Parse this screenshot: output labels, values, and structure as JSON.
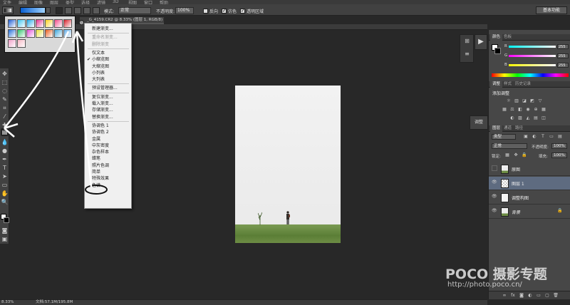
{
  "menubar": [
    "文件",
    "编辑",
    "图像",
    "图层",
    "类型",
    "选择",
    "滤镜",
    "3D",
    "视图",
    "窗口",
    "帮助"
  ],
  "options": {
    "mode_label": "模式:",
    "mode_value": "正常",
    "opacity_label": "不透明度:",
    "opacity_value": "100%",
    "reverse_label": "反向",
    "dither_label": "仿色",
    "transparency_label": "透明区域",
    "workspace": "基本功能"
  },
  "doc_tab": "_G_4159.CR2 @ 8.33% (图层 1, RGB/8) *",
  "gradient_swatches": [
    [
      "#1f5fd4",
      "#3ec6f0",
      "#21a9e8",
      "#e8338f",
      "#ffd21e",
      "#f44d8b",
      "#d8202a"
    ],
    [
      "#2570d8",
      "#2fc56b",
      "#e24fd8",
      "#e8e23a",
      "#eb5f1d",
      "#3da6dc",
      "#66b0ea"
    ],
    [
      "#f0a0c8",
      "#f6b8c4"
    ]
  ],
  "menu": {
    "items": [
      {
        "label": "新建渐变...",
        "disabled": false,
        "checked": false
      },
      {
        "sep": true
      },
      {
        "label": "重命名渐变...",
        "disabled": true,
        "checked": false
      },
      {
        "label": "删除渐变",
        "disabled": true,
        "checked": false
      },
      {
        "sep": true
      },
      {
        "label": "仅文本",
        "disabled": false,
        "checked": false
      },
      {
        "label": "小缩览图",
        "disabled": false,
        "checked": true
      },
      {
        "label": "大缩览图",
        "disabled": false,
        "checked": false
      },
      {
        "label": "小列表",
        "disabled": false,
        "checked": false
      },
      {
        "label": "大列表",
        "disabled": false,
        "checked": false
      },
      {
        "sep": true
      },
      {
        "label": "预设管理器...",
        "disabled": false,
        "checked": false
      },
      {
        "sep": true
      },
      {
        "label": "复位渐变...",
        "disabled": false,
        "checked": false
      },
      {
        "label": "载入渐变...",
        "disabled": false,
        "checked": false
      },
      {
        "label": "存储渐变...",
        "disabled": false,
        "checked": false
      },
      {
        "label": "替换渐变...",
        "disabled": false,
        "checked": false
      },
      {
        "sep": true
      },
      {
        "label": "协调色 1",
        "disabled": false,
        "checked": false
      },
      {
        "label": "协调色 2",
        "disabled": false,
        "checked": false
      },
      {
        "label": "金属",
        "disabled": false,
        "checked": false
      },
      {
        "label": "中灰密度",
        "disabled": false,
        "checked": false
      },
      {
        "label": "杂色样本",
        "disabled": false,
        "checked": false
      },
      {
        "label": "蜡笔",
        "disabled": false,
        "checked": false
      },
      {
        "label": "照片色调",
        "disabled": false,
        "checked": false
      },
      {
        "label": "简单",
        "disabled": false,
        "checked": false
      },
      {
        "label": "特殊效果",
        "disabled": false,
        "checked": false
      },
      {
        "label": "色谱",
        "disabled": false,
        "checked": false
      }
    ]
  },
  "color_panel": {
    "tabs": [
      "颜色",
      "色板"
    ],
    "r_label": "R",
    "r_value": "255",
    "g_label": "G",
    "g_value": "255",
    "b_label": "B",
    "b_value": "255"
  },
  "adjust_panel": {
    "tabs": [
      "调整",
      "样式",
      "历史记录"
    ],
    "title": "添加调整"
  },
  "side_tab": "调整",
  "layers_panel": {
    "tabs": [
      "图层",
      "通道",
      "路径"
    ],
    "filter_kind": "类型",
    "blend_mode": "正常",
    "opacity_label": "不透明度:",
    "opacity_value": "100%",
    "lock_label": "锁定:",
    "fill_label": "填充:",
    "fill_value": "100%",
    "layers": [
      {
        "name": "原图",
        "visible": false,
        "selected": false
      },
      {
        "name": "图层 1",
        "visible": true,
        "selected": true
      },
      {
        "name": "调整构图",
        "visible": true,
        "selected": false
      },
      {
        "name": "背景",
        "visible": true,
        "selected": false
      }
    ]
  },
  "status": {
    "zoom": "8.33%",
    "doc": "文档:57.1M/195.8M"
  },
  "watermark": {
    "logo": "POCO 摄影专题",
    "url": "http://photo.poco.cn/"
  }
}
